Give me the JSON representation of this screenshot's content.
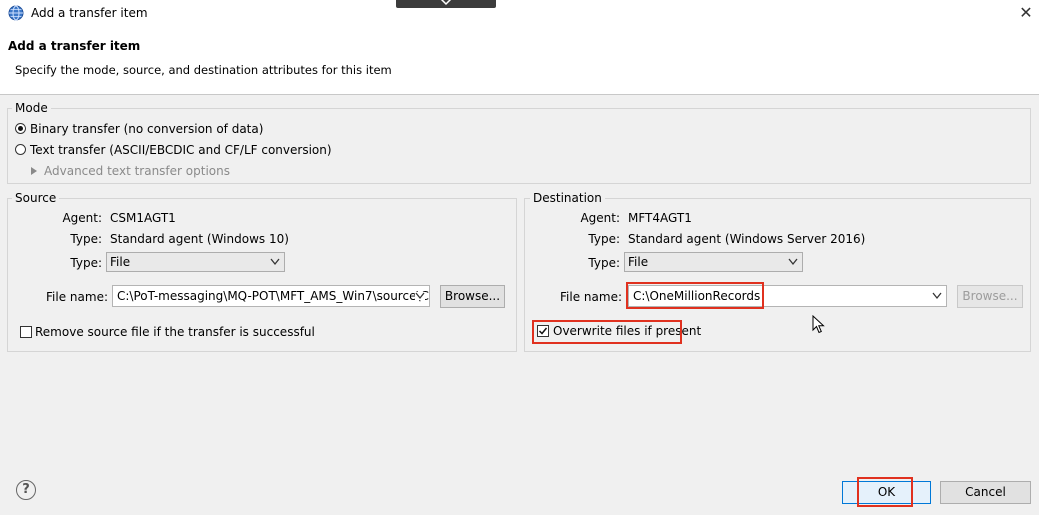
{
  "window": {
    "title": "Add a transfer item",
    "close_symbol": "✕"
  },
  "banner": {
    "title": "Add a transfer item",
    "description": "Specify the mode, source, and destination attributes for this item"
  },
  "mode": {
    "legend": "Mode",
    "options": [
      {
        "label": "Binary transfer (no conversion of data)",
        "selected": true
      },
      {
        "label": "Text transfer (ASCII/EBCDIC and CF/LF conversion)",
        "selected": false
      }
    ],
    "advanced_label": "Advanced text transfer options"
  },
  "source": {
    "legend": "Source",
    "agent_label": "Agent:",
    "agent_value": "CSM1AGT1",
    "type_label": "Type:",
    "type_value": "Standard agent (Windows 10)",
    "type_select_label": "Type:",
    "type_select_value": "File",
    "file_name_label": "File name:",
    "file_name_value": "C:\\PoT-messaging\\MQ-POT\\MFT_AMS_Win7\\source\\C",
    "browse_label": "Browse...",
    "remove_label": "Remove source file if the transfer is successful",
    "remove_checked": false
  },
  "destination": {
    "legend": "Destination",
    "agent_label": "Agent:",
    "agent_value": "MFT4AGT1",
    "type_label": "Type:",
    "type_value": "Standard agent (Windows Server 2016)",
    "type_select_label": "Type:",
    "type_select_value": "File",
    "file_name_label": "File name:",
    "file_name_value": "C:\\OneMillionRecords",
    "browse_label": "Browse...",
    "overwrite_label": "Overwrite files if present",
    "overwrite_checked": true
  },
  "footer": {
    "help_symbol": "?",
    "ok_label": "OK",
    "cancel_label": "Cancel"
  },
  "colors": {
    "highlight": "#e0311f",
    "accent": "#0078d7"
  }
}
